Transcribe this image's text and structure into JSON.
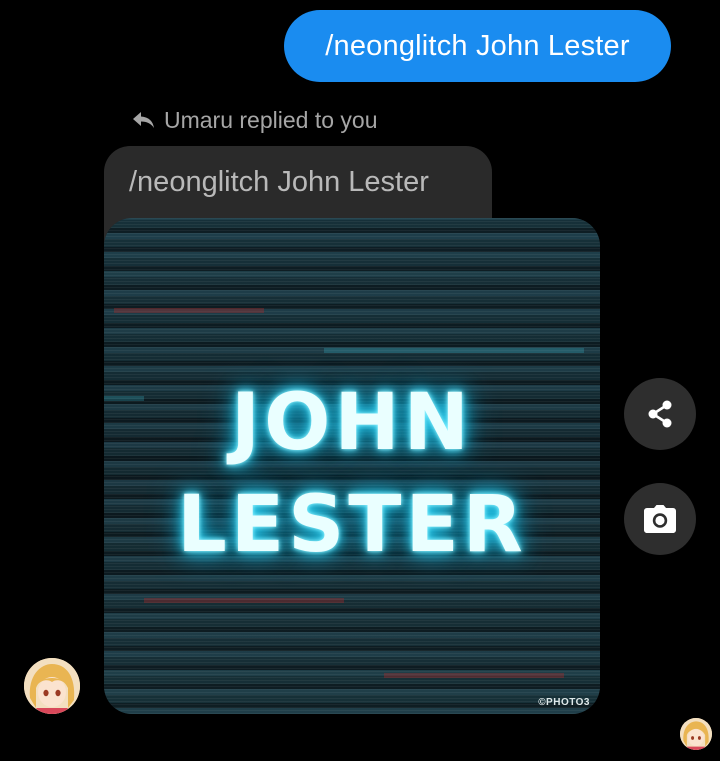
{
  "sent_message": {
    "text": "/neonglitch John Lester"
  },
  "reply": {
    "header_text": "Umaru replied to you",
    "quoted_text": "/neonglitch John Lester"
  },
  "image": {
    "line1": "JOHN",
    "line2": "LESTER",
    "watermark": "©PHOTO3"
  },
  "actions": {
    "share_icon": "share-icon",
    "camera_icon": "camera-icon"
  },
  "colors": {
    "sent_bubble": "#1a8cf0",
    "quoted_bubble": "#2a2a2a",
    "action_button": "#2e2e2e",
    "neon_glow": "#3fe0ff"
  }
}
